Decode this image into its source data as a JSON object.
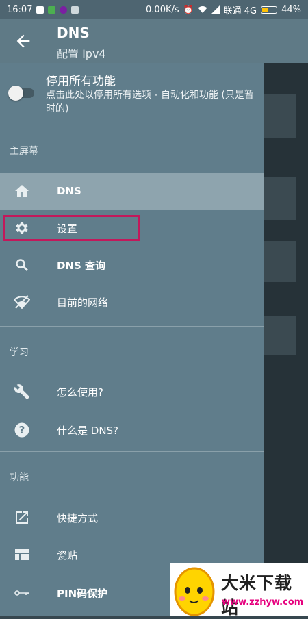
{
  "status_bar": {
    "time": "16:07",
    "network_speed": "0.00K/s",
    "carrier": "联通 4G",
    "battery": "44%",
    "battery_level": 0.44
  },
  "app_bar": {
    "back_icon": "arrow-left-icon",
    "title": "DNS",
    "subtitle": "配置 Ipv4"
  },
  "drawer": {
    "disable_all": {
      "title": "停用所有功能",
      "description": "点击此处以停用所有选项 - 自动化和功能 (只是暂时的)",
      "enabled": false
    },
    "sections": [
      {
        "title": "主屏幕",
        "items": [
          {
            "label": "DNS",
            "icon": "home-icon",
            "selected": true
          },
          {
            "label": "设置",
            "icon": "gear-icon",
            "selected": false
          },
          {
            "label": "DNS 查询",
            "icon": "search-icon",
            "selected": false
          },
          {
            "label": "目前的网络",
            "icon": "wifi-icon",
            "selected": false
          }
        ]
      },
      {
        "title": "学习",
        "items": [
          {
            "label": "怎么使用?",
            "icon": "wrench-icon",
            "selected": false
          },
          {
            "label": "什么是 DNS?",
            "icon": "help-icon",
            "selected": false
          }
        ]
      },
      {
        "title": "功能",
        "items": [
          {
            "label": "快捷方式",
            "icon": "open-in-new-icon",
            "selected": false
          },
          {
            "label": "瓷贴",
            "icon": "tiles-icon",
            "selected": false
          },
          {
            "label": "PIN码保护",
            "icon": "key-icon",
            "selected": false
          }
        ]
      }
    ]
  },
  "watermark": {
    "title": "大米下载站",
    "url": "www.zzhyw.com"
  },
  "colors": {
    "status_bar": "#4e6571",
    "app_bar": "#5f7a86",
    "drawer": "#607d8b",
    "selected_item": "#8ea4ae",
    "highlight_box": "#c2185b"
  }
}
